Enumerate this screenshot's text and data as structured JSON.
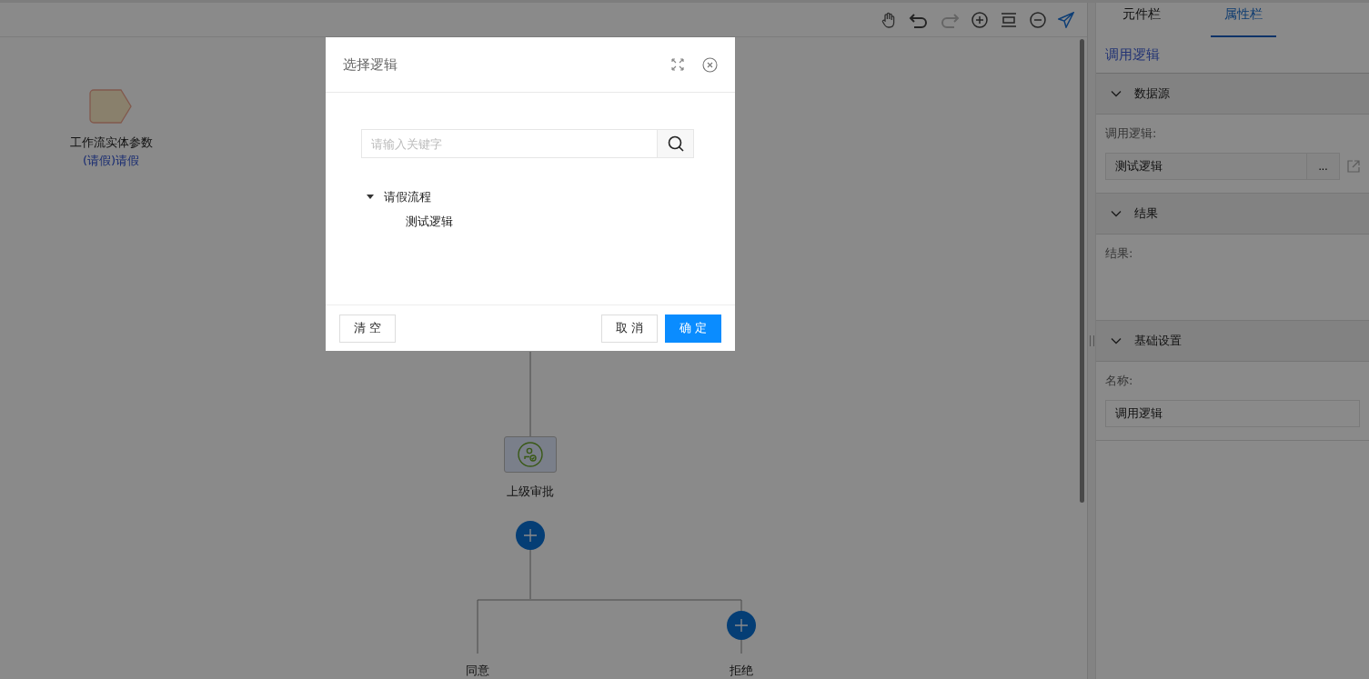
{
  "canvas": {
    "start_node": {
      "title": "工作流实体参数",
      "subtitle": "(请假)请假"
    },
    "approval_node": {
      "label": "上级审批"
    },
    "branches": [
      {
        "label": "同意",
        "add_button": false
      },
      {
        "label": "拒绝",
        "add_button": true
      }
    ]
  },
  "panel": {
    "tabs": [
      {
        "label": "元件栏",
        "selected": false
      },
      {
        "label": "属性栏",
        "selected": true
      }
    ],
    "heading": "调用逻辑",
    "sections": [
      {
        "title": "数据源",
        "expanded": true,
        "field": {
          "kind": "picker",
          "label": "调用逻辑:",
          "value": "测试逻辑",
          "button": "..."
        }
      },
      {
        "title": "结果",
        "expanded": true,
        "field": {
          "kind": "empty",
          "label": "结果:"
        }
      },
      {
        "title": "基础设置",
        "expanded": true,
        "field": {
          "kind": "text",
          "label": "名称:",
          "value": "调用逻辑"
        }
      }
    ]
  },
  "dialog": {
    "title": "选择逻辑",
    "search": {
      "placeholder": "请输入关键字"
    },
    "tree": [
      {
        "label": "请假流程",
        "expanded": true,
        "children": [
          {
            "label": "测试逻辑",
            "selected": false
          }
        ]
      }
    ],
    "buttons": [
      {
        "label": "清 空",
        "kind": "default"
      },
      {
        "label": "取 消",
        "kind": "default"
      },
      {
        "label": "确 定",
        "kind": "primary"
      }
    ]
  }
}
